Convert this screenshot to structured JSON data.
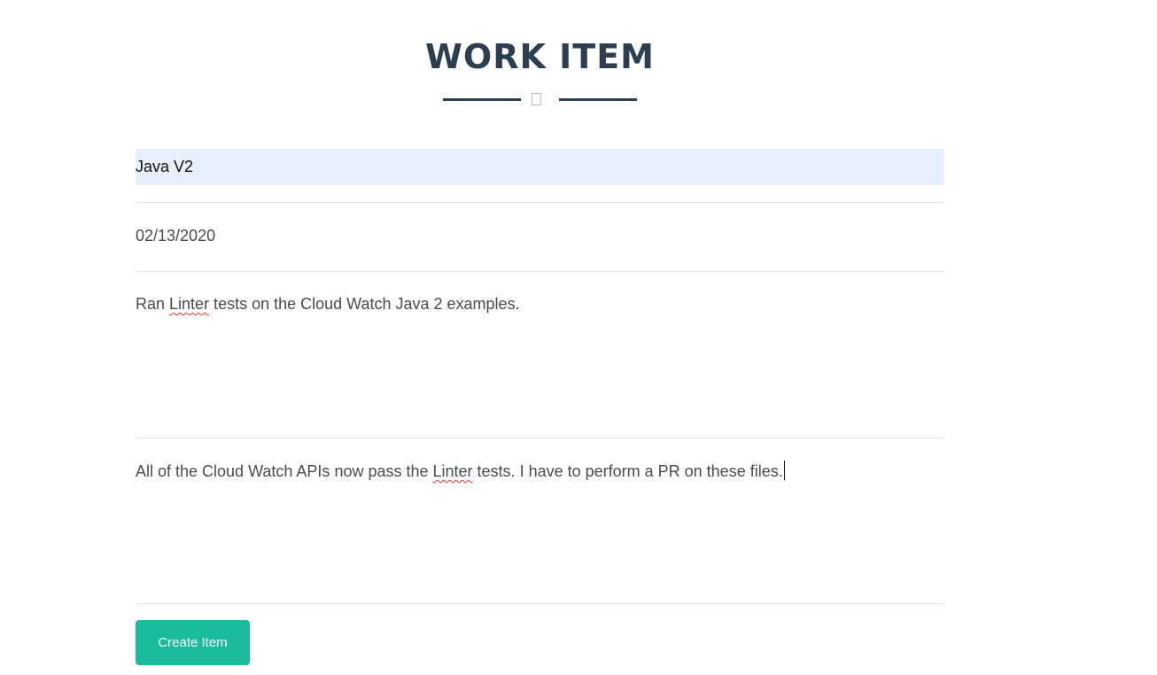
{
  "header": {
    "title": "WORK ITEM"
  },
  "form": {
    "title_value": "Java V2",
    "date_value": "02/13/2020",
    "description_prefix": "Ran ",
    "description_flagged": "Linter",
    "description_suffix": " tests on the Cloud Watch Java 2 examples.",
    "status_prefix": "All of the Cloud Watch APIs now pass the ",
    "status_flagged": "Linter",
    "status_suffix": " tests. I have to perform a PR on these files."
  },
  "actions": {
    "create_label": "Create Item"
  },
  "colors": {
    "accent": "#1abc9c",
    "heading": "#2c3e50",
    "autofill_bg": "#e8f0fe",
    "spellcheck": "#e53935"
  },
  "icons": {
    "divider": "star-icon"
  }
}
